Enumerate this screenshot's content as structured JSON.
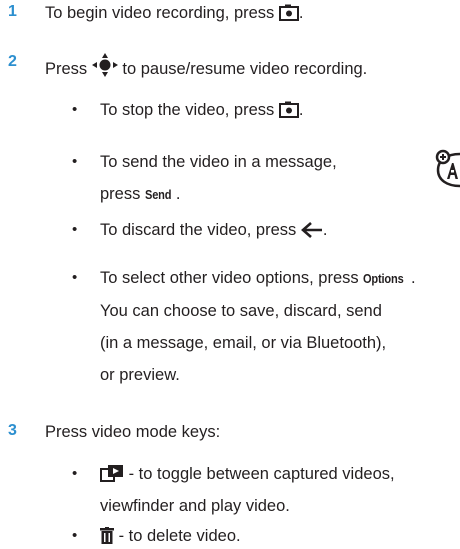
{
  "steps": [
    {
      "number": "1",
      "text": "To begin video recording, press",
      "tail": "."
    },
    {
      "number": "2",
      "text": "Press",
      "tail": " to pause/resume video recording."
    },
    {
      "number": "3",
      "text": "Press video mode keys:",
      "tail": ""
    }
  ],
  "step2_bullets": {
    "b1": {
      "text": "To stop the video, press",
      "tail": "."
    },
    "b2": {
      "line1": "To send the video in a message,",
      "line2_pre": "press ",
      "key": "Send",
      "line2_post": "."
    },
    "b3": {
      "text": "To discard the video, press",
      "tail": "."
    },
    "b4": {
      "pre": "To select other video options, press ",
      "key": "Options",
      "post": ".",
      "line2": "You can choose to save, discard, send",
      "line3": "(in a message, email, or via Bluetooth),",
      "line4": "or preview."
    }
  },
  "step3_bullets": {
    "b1": {
      "line1": " - to toggle between captured videos,",
      "line2": "viewfinder and play video."
    },
    "b2": {
      "text": " - to delete video."
    }
  },
  "bullet_glyph": "•",
  "icons": {
    "camera_key": "camera-key-icon",
    "nav_key": "navigation-key-icon",
    "back_key": "back-arrow-icon",
    "toggle_key": "toggle-video-icon",
    "delete_key": "trash-icon",
    "side_badge": "accessory-badge-icon"
  },
  "colors": {
    "step_number": "#2c8fcf",
    "text": "#231f20"
  }
}
